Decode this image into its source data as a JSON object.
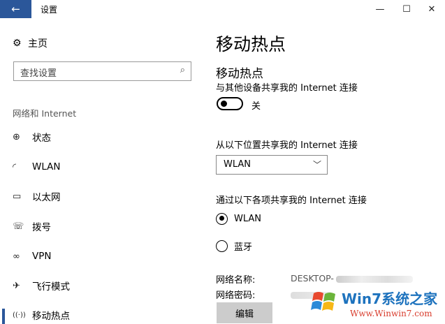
{
  "window": {
    "title": "设置",
    "back_icon": "←",
    "minimize_icon": "—",
    "maximize_icon": "☐",
    "close_icon": "✕"
  },
  "sidebar": {
    "home_label": "主页",
    "home_icon": "⚙",
    "search_placeholder": "查找设置",
    "search_icon": "⌕",
    "section_label": "网络和 Internet",
    "items": [
      {
        "label": "状态",
        "icon": "⊕"
      },
      {
        "label": "WLAN",
        "icon": "◜"
      },
      {
        "label": "以太网",
        "icon": "▭"
      },
      {
        "label": "拨号",
        "icon": "☏"
      },
      {
        "label": "VPN",
        "icon": "∞"
      },
      {
        "label": "飞行模式",
        "icon": "✈"
      },
      {
        "label": "移动热点",
        "icon": "((·))"
      }
    ],
    "active_index": 6
  },
  "main": {
    "page_title": "移动热点",
    "sub_title": "移动热点",
    "share_desc": "与其他设备共享我的 Internet 连接",
    "toggle_state": "关",
    "toggle_on": false,
    "share_from_label": "从以下位置共享我的 Internet 连接",
    "share_from_value": "WLAN",
    "share_over_label": "通过以下各项共享我的 Internet 连接",
    "radio_options": [
      {
        "label": "WLAN",
        "selected": true
      },
      {
        "label": "蓝牙",
        "selected": false
      }
    ],
    "network_name_label": "网络名称:",
    "network_name_value": "DESKTOP-",
    "network_password_label": "网络密码:",
    "edit_button": "编辑"
  },
  "watermark": {
    "text": "Win7系统之家",
    "url": "Www.Winwin7.com"
  }
}
